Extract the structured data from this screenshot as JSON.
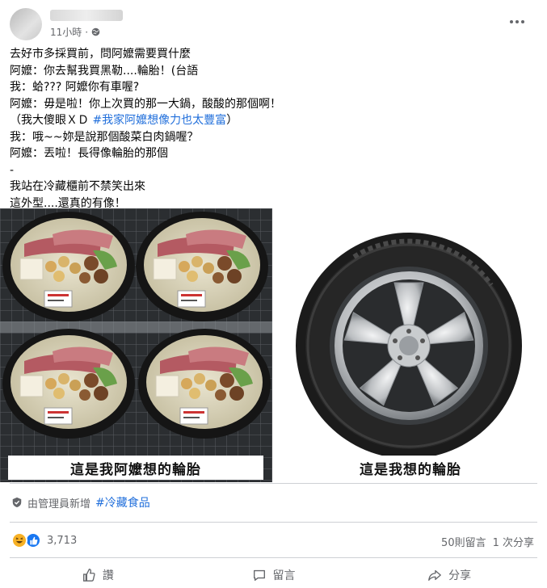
{
  "post": {
    "timestamp": "11小時",
    "lines": [
      "去好市多採買前，問阿嬤需要買什麼",
      "阿嬤：你去幫我買黑勒....輪胎！(台語",
      "我：蛤??? 阿嬤你有車喔?",
      "阿嬤：毋是啦！你上次買的那一大鍋，酸酸的那個啊！",
      "（我大傻眼ＸＤ ",
      "我：哦~~妳是說那個酸菜白肉鍋喔？",
      "阿嬤：丟啦！長得像輪胎的那個",
      "-",
      "我站在冷藏櫃前不禁笑出來",
      "這外型....還真的有像！"
    ],
    "line5_hashtag": "#我家阿嬤想像力也太豐富",
    "line5_suffix": "）"
  },
  "images": {
    "left_caption": "這是我阿嬤想的輪胎",
    "right_caption": "這是我想的輪胎"
  },
  "admin": {
    "label": "由管理員新增",
    "tag": "#冷藏食品"
  },
  "stats": {
    "reaction_count": "3,713",
    "comments": "50則留言",
    "shares": "1 次分享"
  },
  "actions": {
    "like": "讚",
    "comment": "留言",
    "share": "分享"
  },
  "colors": {
    "hashtag": "#216fdb",
    "like_blue": "#1877f2",
    "haha_yellow": "#f7b125"
  },
  "icons": [
    "globe-icon",
    "more-icon",
    "shield-icon",
    "haha-icon",
    "like-icon",
    "comment-icon",
    "share-icon"
  ]
}
